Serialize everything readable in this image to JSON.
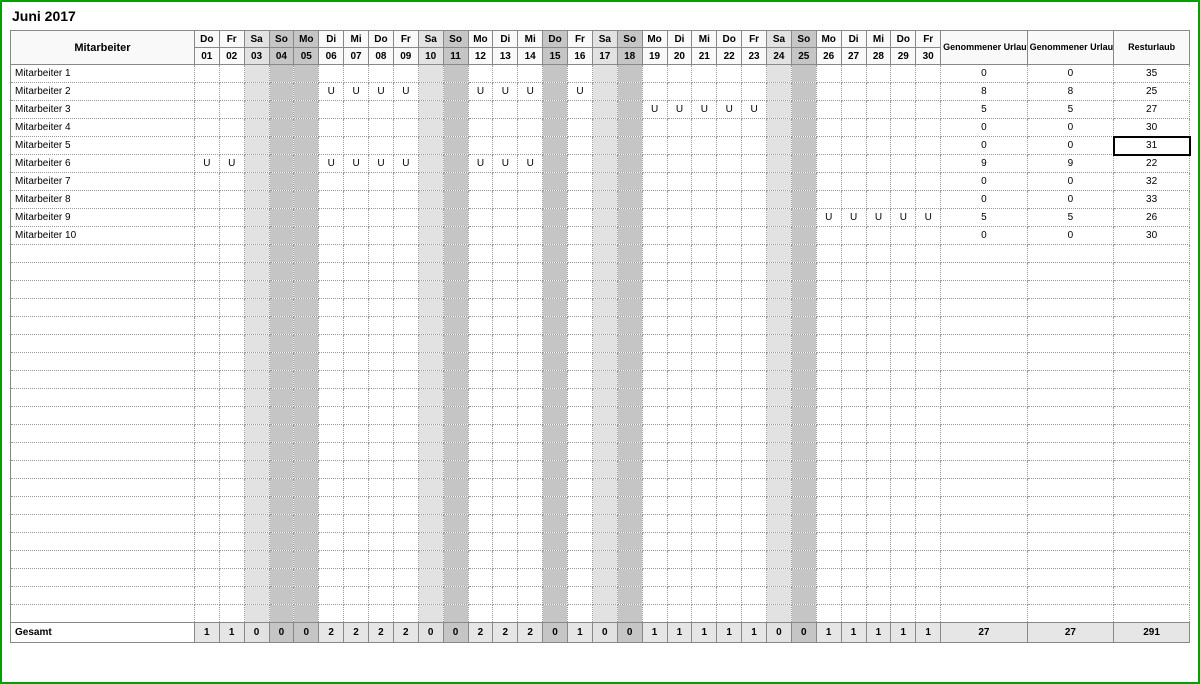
{
  "title": "Juni 2017",
  "headers": {
    "employee": "Mitarbeiter",
    "sumMonth": "Genommener Urlaub Monat",
    "sumYear": "Genommener Urlaub Jahr",
    "rest": "Resturlaub",
    "totals": "Gesamt"
  },
  "days": [
    {
      "dow": "Do",
      "num": "01",
      "shade": 0
    },
    {
      "dow": "Fr",
      "num": "02",
      "shade": 0
    },
    {
      "dow": "Sa",
      "num": "03",
      "shade": 1
    },
    {
      "dow": "So",
      "num": "04",
      "shade": 2
    },
    {
      "dow": "Mo",
      "num": "05",
      "shade": 2
    },
    {
      "dow": "Di",
      "num": "06",
      "shade": 0
    },
    {
      "dow": "Mi",
      "num": "07",
      "shade": 0
    },
    {
      "dow": "Do",
      "num": "08",
      "shade": 0
    },
    {
      "dow": "Fr",
      "num": "09",
      "shade": 0
    },
    {
      "dow": "Sa",
      "num": "10",
      "shade": 1
    },
    {
      "dow": "So",
      "num": "11",
      "shade": 2
    },
    {
      "dow": "Mo",
      "num": "12",
      "shade": 0
    },
    {
      "dow": "Di",
      "num": "13",
      "shade": 0
    },
    {
      "dow": "Mi",
      "num": "14",
      "shade": 0
    },
    {
      "dow": "Do",
      "num": "15",
      "shade": 2
    },
    {
      "dow": "Fr",
      "num": "16",
      "shade": 0
    },
    {
      "dow": "Sa",
      "num": "17",
      "shade": 1
    },
    {
      "dow": "So",
      "num": "18",
      "shade": 2
    },
    {
      "dow": "Mo",
      "num": "19",
      "shade": 0
    },
    {
      "dow": "Di",
      "num": "20",
      "shade": 0
    },
    {
      "dow": "Mi",
      "num": "21",
      "shade": 0
    },
    {
      "dow": "Do",
      "num": "22",
      "shade": 0
    },
    {
      "dow": "Fr",
      "num": "23",
      "shade": 0
    },
    {
      "dow": "Sa",
      "num": "24",
      "shade": 1
    },
    {
      "dow": "So",
      "num": "25",
      "shade": 2
    },
    {
      "dow": "Mo",
      "num": "26",
      "shade": 0
    },
    {
      "dow": "Di",
      "num": "27",
      "shade": 0
    },
    {
      "dow": "Mi",
      "num": "28",
      "shade": 0
    },
    {
      "dow": "Do",
      "num": "29",
      "shade": 0
    },
    {
      "dow": "Fr",
      "num": "30",
      "shade": 0
    }
  ],
  "employees": [
    {
      "name": "Mitarbeiter 1",
      "cells": [
        "",
        "",
        "",
        "",
        "",
        "",
        "",
        "",
        "",
        "",
        "",
        "",
        "",
        "",
        "",
        "",
        "",
        "",
        "",
        "",
        "",
        "",
        "",
        "",
        "",
        "",
        "",
        "",
        "",
        ""
      ],
      "sumM": "0",
      "sumY": "0",
      "rest": "35"
    },
    {
      "name": "Mitarbeiter 2",
      "cells": [
        "",
        "",
        "",
        "",
        "",
        "U",
        "U",
        "U",
        "U",
        "",
        "",
        "U",
        "U",
        "U",
        "",
        "U",
        "",
        "",
        "",
        "",
        "",
        "",
        "",
        "",
        "",
        "",
        "",
        "",
        "",
        ""
      ],
      "sumM": "8",
      "sumY": "8",
      "rest": "25"
    },
    {
      "name": "Mitarbeiter 3",
      "cells": [
        "",
        "",
        "",
        "",
        "",
        "",
        "",
        "",
        "",
        "",
        "",
        "",
        "",
        "",
        "",
        "",
        "",
        "",
        "U",
        "U",
        "U",
        "U",
        "U",
        "",
        "",
        "",
        "",
        "",
        "",
        ""
      ],
      "sumM": "5",
      "sumY": "5",
      "rest": "27"
    },
    {
      "name": "Mitarbeiter 4",
      "cells": [
        "",
        "",
        "",
        "",
        "",
        "",
        "",
        "",
        "",
        "",
        "",
        "",
        "",
        "",
        "",
        "",
        "",
        "",
        "",
        "",
        "",
        "",
        "",
        "",
        "",
        "",
        "",
        "",
        "",
        ""
      ],
      "sumM": "0",
      "sumY": "0",
      "rest": "30"
    },
    {
      "name": "Mitarbeiter 5",
      "cells": [
        "",
        "",
        "",
        "",
        "",
        "",
        "",
        "",
        "",
        "",
        "",
        "",
        "",
        "",
        "",
        "",
        "",
        "",
        "",
        "",
        "",
        "",
        "",
        "",
        "",
        "",
        "",
        "",
        "",
        ""
      ],
      "sumM": "0",
      "sumY": "0",
      "rest": "31",
      "selectedRest": true
    },
    {
      "name": "Mitarbeiter 6",
      "cells": [
        "U",
        "U",
        "",
        "",
        "",
        "U",
        "U",
        "U",
        "U",
        "",
        "",
        "U",
        "U",
        "U",
        "",
        "",
        "",
        "",
        "",
        "",
        "",
        "",
        "",
        "",
        "",
        "",
        "",
        "",
        "",
        ""
      ],
      "sumM": "9",
      "sumY": "9",
      "rest": "22"
    },
    {
      "name": "Mitarbeiter 7",
      "cells": [
        "",
        "",
        "",
        "",
        "",
        "",
        "",
        "",
        "",
        "",
        "",
        "",
        "",
        "",
        "",
        "",
        "",
        "",
        "",
        "",
        "",
        "",
        "",
        "",
        "",
        "",
        "",
        "",
        "",
        ""
      ],
      "sumM": "0",
      "sumY": "0",
      "rest": "32"
    },
    {
      "name": "Mitarbeiter 8",
      "cells": [
        "",
        "",
        "",
        "",
        "",
        "",
        "",
        "",
        "",
        "",
        "",
        "",
        "",
        "",
        "",
        "",
        "",
        "",
        "",
        "",
        "",
        "",
        "",
        "",
        "",
        "",
        "",
        "",
        "",
        ""
      ],
      "sumM": "0",
      "sumY": "0",
      "rest": "33"
    },
    {
      "name": "Mitarbeiter 9",
      "cells": [
        "",
        "",
        "",
        "",
        "",
        "",
        "",
        "",
        "",
        "",
        "",
        "",
        "",
        "",
        "",
        "",
        "",
        "",
        "",
        "",
        "",
        "",
        "",
        "",
        "",
        "U",
        "U",
        "U",
        "U",
        "U"
      ],
      "sumM": "5",
      "sumY": "5",
      "rest": "26"
    },
    {
      "name": "Mitarbeiter 10",
      "cells": [
        "",
        "",
        "",
        "",
        "",
        "",
        "",
        "",
        "",
        "",
        "",
        "",
        "",
        "",
        "",
        "",
        "",
        "",
        "",
        "",
        "",
        "",
        "",
        "",
        "",
        "",
        "",
        "",
        "",
        ""
      ],
      "sumM": "0",
      "sumY": "0",
      "rest": "30"
    }
  ],
  "emptyRows": 21,
  "totals": {
    "days": [
      "1",
      "1",
      "0",
      "0",
      "0",
      "2",
      "2",
      "2",
      "2",
      "0",
      "0",
      "2",
      "2",
      "2",
      "0",
      "1",
      "0",
      "0",
      "1",
      "1",
      "1",
      "1",
      "1",
      "0",
      "0",
      "1",
      "1",
      "1",
      "1",
      "1"
    ],
    "sumM": "27",
    "sumY": "27",
    "rest": "291"
  }
}
